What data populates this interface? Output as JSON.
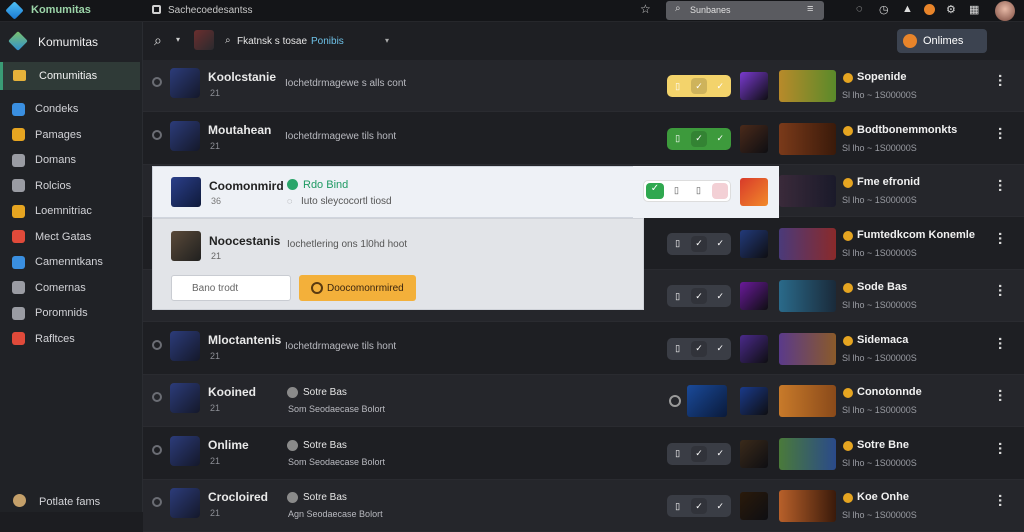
{
  "browser": {
    "app_title": "Komumitas",
    "address": "Sachecoedesantss",
    "search_placeholder": "Sunbanes",
    "icons": [
      "star-icon",
      "menu-icon",
      "chat-icon",
      "clock-icon",
      "bell-icon",
      "flame-icon",
      "settings-icon",
      "grid-icon",
      "avatar"
    ]
  },
  "sidebar": {
    "brand": "Komumitas",
    "active": "Comumitias",
    "items": [
      {
        "label": "Condeks",
        "color": "#3a8fe0"
      },
      {
        "label": "Pamages",
        "color": "#e6a521"
      },
      {
        "label": "Domans",
        "color": "#9a9ca3"
      },
      {
        "label": "Rolcios",
        "color": "#9a9ca3"
      },
      {
        "label": "Loemnitriac",
        "color": "#e6a521"
      },
      {
        "label": "Mect Gatas",
        "color": "#e04a3a"
      },
      {
        "label": "Camenntkans",
        "color": "#3a8fe0"
      },
      {
        "label": "Comernas",
        "color": "#9a9ca3"
      },
      {
        "label": "Poromnids",
        "color": "#9a9ca3"
      },
      {
        "label": "Rafltces",
        "color": "#e04a3a"
      }
    ],
    "footer": "Potlate fams"
  },
  "header": {
    "filter_text": "Fkatnsk s tosae",
    "filter_accent": "Ponibis",
    "online_button": "Onlimes"
  },
  "rows": [
    {
      "name": "Koolcstanie",
      "count": "21",
      "desc": "Iochetdrmagewe s alls cont",
      "pill": [
        "▯",
        "✓",
        "✓"
      ],
      "pill_color": "#f3d36b",
      "right_title": "Sopenide",
      "right_sub": "Sl lho ~ 1S00000S"
    },
    {
      "name": "Moutahean",
      "count": "21",
      "desc": "Iochetdrmagewe tils hont",
      "pill": [
        "▯",
        "✓",
        "✓"
      ],
      "pill_color": "#3d9a3c",
      "right_title": "Bodtbonemmonkts",
      "right_sub": "Sl lho ~ 1S00000S"
    },
    {
      "name": "Coomonmird",
      "count": "36",
      "desc": "Rdo Bind",
      "desc2": "Iuto sleycocortl tiosd",
      "pill": [
        "✓",
        "▯",
        "▯"
      ],
      "pill_color": "#ffffff",
      "right_title": "Fme efronid",
      "right_sub": "Sl lho ~ 1S00000S"
    },
    {
      "name": "Noocestanis",
      "count": "21",
      "desc": "Iochetlering ons 1l0hd hoot",
      "input_placeholder": "Bano trodt",
      "button": "Doocomonrmired",
      "pill": [
        "▯",
        "✓",
        "✓"
      ],
      "pill_color": "#3a3d45",
      "right_title": "Fumtedkcom Konemle",
      "right_sub": "Sl lho ~ 1S00000S"
    },
    {
      "name": "",
      "count": "",
      "desc": "",
      "pill": [
        "▯",
        "✓",
        "✓"
      ],
      "pill_color": "#3a3d45",
      "right_title": "Sode Bas",
      "right_sub": "Sl lho ~ 1S00000S"
    },
    {
      "name": "Mloctantenis",
      "count": "21",
      "desc": "Iochetdrmagewe tils hont",
      "pill": [
        "▯",
        "✓",
        "✓"
      ],
      "pill_color": "#3a3d45",
      "right_title": "Sidemaca",
      "right_sub": "Sl lho ~ 1S00000S"
    },
    {
      "name": "Kooined",
      "count": "21",
      "desc": "Sotre Bas",
      "desc2": "Som Seodaecase Bolort",
      "pill": [
        "",
        "",
        ""
      ],
      "pill_color": "#1e1f23",
      "right_title": "Conotonnde",
      "right_sub": "Sl lho ~ 1S00000S"
    },
    {
      "name": "Onlime",
      "count": "21",
      "desc": "Sotre Bas",
      "desc2": "Som Seodaecase Bolort",
      "pill": [
        "▯",
        "✓",
        "✓"
      ],
      "pill_color": "#3a3d45",
      "right_title": "Sotre Bne",
      "right_sub": "Sl lho ~ 1S00000S"
    },
    {
      "name": "Crocloired",
      "count": "21",
      "desc": "Sotre Bas",
      "desc2": "Agn Seodaecase Bolort",
      "pill": [
        "▯",
        "✓",
        "✓"
      ],
      "pill_color": "#3a3d45",
      "right_title": "Koe Onhe",
      "right_sub": "Sl lho ~ 1S00000S"
    }
  ]
}
